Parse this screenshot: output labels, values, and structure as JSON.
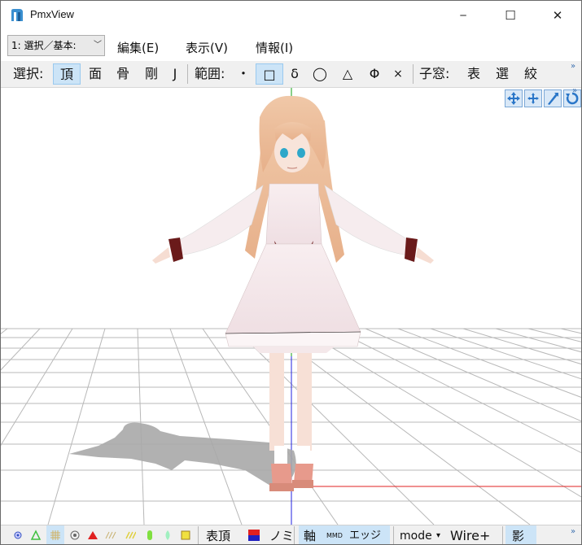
{
  "window": {
    "title": "PmxView",
    "minimize_glyph": "─",
    "maximize_glyph": "☐",
    "close_glyph": "✕"
  },
  "menubar": {
    "mode_select": {
      "selected": "1: 選択／基本:",
      "arrow": "﹀"
    },
    "items": [
      "編集(E)",
      "表示(V)",
      "情報(I)"
    ]
  },
  "toolbar": {
    "select_label": "選択:",
    "select_items": [
      "頂",
      "面",
      "骨",
      "剛",
      "J"
    ],
    "range_label": "範囲:",
    "range_items": [
      "・",
      "□",
      "δ",
      "◯",
      "△",
      "Φ",
      "×"
    ],
    "child_label": "子窓:",
    "child_items": [
      "表",
      "選",
      "絞"
    ],
    "overflow": "»"
  },
  "viewport": {
    "buttons": [
      "move-view-icon",
      "move-axes-icon",
      "zoom-icon",
      "rotate-icon"
    ],
    "overflow": "»"
  },
  "statusbar": {
    "hyo_label": "表頂",
    "no_label": "ノミ",
    "axis_label": "軸",
    "mmd_label": "MMD",
    "edge_label": "エッジ",
    "mode_label": "mode",
    "mode_arrow": "▾",
    "wire_label": "Wire+",
    "shadow_label": "影",
    "overflow": "»"
  },
  "colors": {
    "accent_selected": "#cce4f7",
    "grid_line": "#b8b8b8",
    "axis_x": "#e02020",
    "axis_y": "#10a010",
    "axis_z": "#2020e0"
  }
}
